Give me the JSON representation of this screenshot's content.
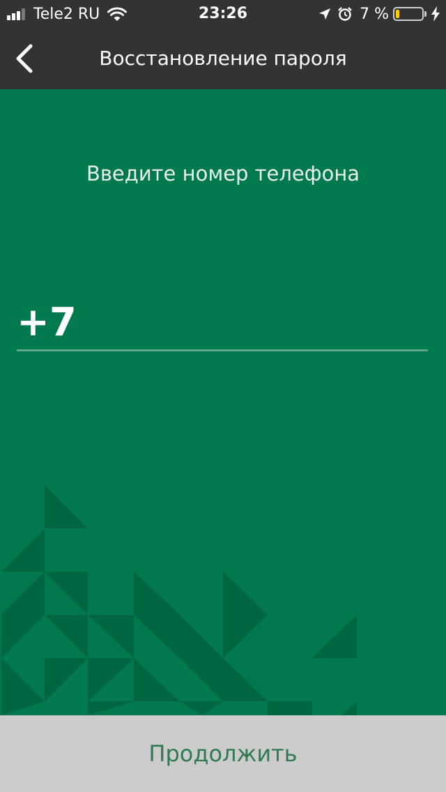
{
  "status_bar": {
    "carrier": "Tele2 RU",
    "time": "23:26",
    "battery_percent": "7 %",
    "battery_level": 0.07,
    "icons": [
      "signal-icon",
      "wifi-icon",
      "location-arrow-icon",
      "alarm-icon",
      "battery-icon",
      "charging-bolt-icon"
    ]
  },
  "nav": {
    "title": "Восстановление пароля",
    "back_icon": "chevron-left-icon"
  },
  "form": {
    "prompt": "Введите номер телефона",
    "phone_value": "+7"
  },
  "footer": {
    "continue_label": "Продолжить"
  },
  "colors": {
    "bar_background": "#333333",
    "content_background": "#007A4D",
    "pattern_triangle": "#00663F",
    "button_background": "#CCCCCC",
    "button_text": "#2F7A50",
    "battery_fill": "#FFCC00"
  }
}
